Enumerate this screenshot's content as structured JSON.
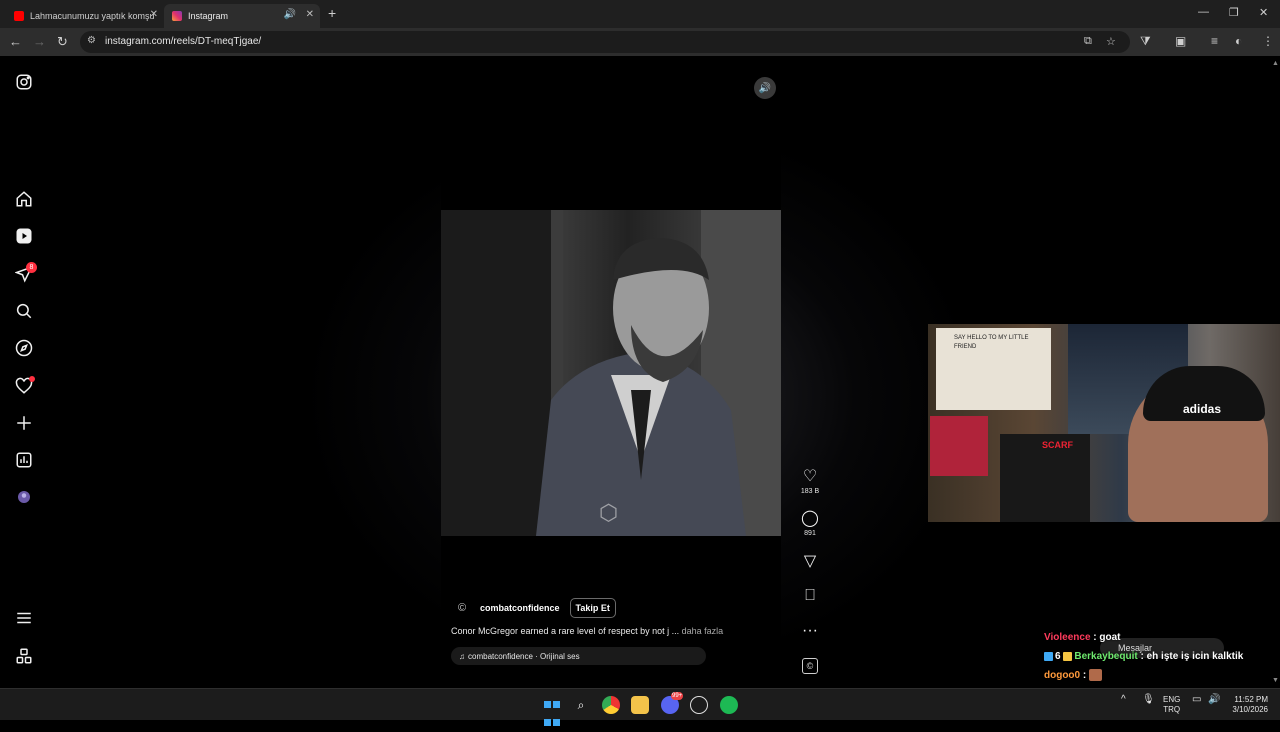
{
  "browser": {
    "tabs": [
      {
        "title": "Lahmacunumuzu yaptık komşu",
        "active": false,
        "favicon_color": "#ff0000"
      },
      {
        "title": "Instagram",
        "active": true,
        "favicon_color": "#e1306c"
      }
    ],
    "address": "instagram.com/reels/DT-meqTjgae/"
  },
  "sidebar": {
    "items": [
      {
        "name": "instagram-logo"
      },
      {
        "name": "home"
      },
      {
        "name": "reels"
      },
      {
        "name": "messages",
        "badge": "8"
      },
      {
        "name": "search"
      },
      {
        "name": "explore"
      },
      {
        "name": "notifications"
      },
      {
        "name": "create"
      },
      {
        "name": "dashboard"
      },
      {
        "name": "profile"
      },
      {
        "name": "more"
      },
      {
        "name": "also-from-meta"
      }
    ]
  },
  "reel": {
    "author": "combatconfidence",
    "follow_label": "Takip Et",
    "caption": "Conor McGregor earned a rare level of respect by not j ...",
    "more_label": "daha fazla",
    "audio": "combatconfidence · Orijinal ses",
    "likes": "183 B",
    "comments": "891"
  },
  "webcam": {
    "poster_text": "SAY HELLO TO MY LITTLE FRIEND",
    "cap_logo": "adidas",
    "poster2_text": "SCARF"
  },
  "chat": {
    "messages_pill": "Mesajlar",
    "lines": [
      {
        "user": "Violeence",
        "user_color": "#ff3b5c",
        "sep": " : ",
        "msg": "goat",
        "emote": false
      },
      {
        "user": "Berkaybequit",
        "user_color": "#6ee96e",
        "prefix": "6",
        "sep": " : ",
        "msg": "eh işte iş icin kalktik",
        "emote": false
      },
      {
        "user": "dogoo0",
        "user_color": "#ff9a3c",
        "sep": " : ",
        "msg": "",
        "emote": true
      },
      {
        "user": "dogoo0",
        "user_color": "#ff9a3c",
        "sep": " : ",
        "msg": "",
        "emote": true
      },
      {
        "user": "dogoo0",
        "user_color": "#ff9a3c",
        "sep": " : ",
        "msg": "",
        "emote": true
      }
    ]
  },
  "taskbar": {
    "discord_badge": "99+",
    "lang_top": "ENG",
    "lang_bottom": "TRQ",
    "time": "11:52 PM",
    "date": "3/10/2026"
  }
}
